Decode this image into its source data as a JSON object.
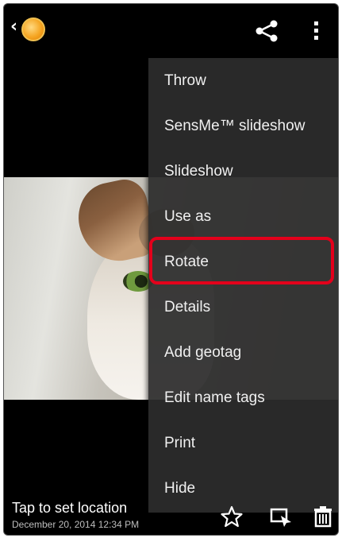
{
  "toolbar": {
    "back_glyph": "‹",
    "icons": [
      "app-icon",
      "share-icon",
      "overflow-menu-icon"
    ]
  },
  "menu": {
    "items": [
      {
        "label": "Throw"
      },
      {
        "label": "SensMe™ slideshow"
      },
      {
        "label": "Slideshow"
      },
      {
        "label": "Use as"
      },
      {
        "label": "Rotate",
        "highlighted": true
      },
      {
        "label": "Details"
      },
      {
        "label": "Add geotag"
      },
      {
        "label": "Edit name tags"
      },
      {
        "label": "Print"
      },
      {
        "label": "Hide"
      }
    ]
  },
  "photo_info": {
    "location": "Tap to set location",
    "date": "December 20, 2014 12:34 PM"
  },
  "bottom_actions": [
    "favorite-star-icon",
    "edit-icon",
    "delete-icon"
  ],
  "colors": {
    "highlight": "#e3001b",
    "menu_background": "#2c2c2c",
    "background": "#000000"
  }
}
